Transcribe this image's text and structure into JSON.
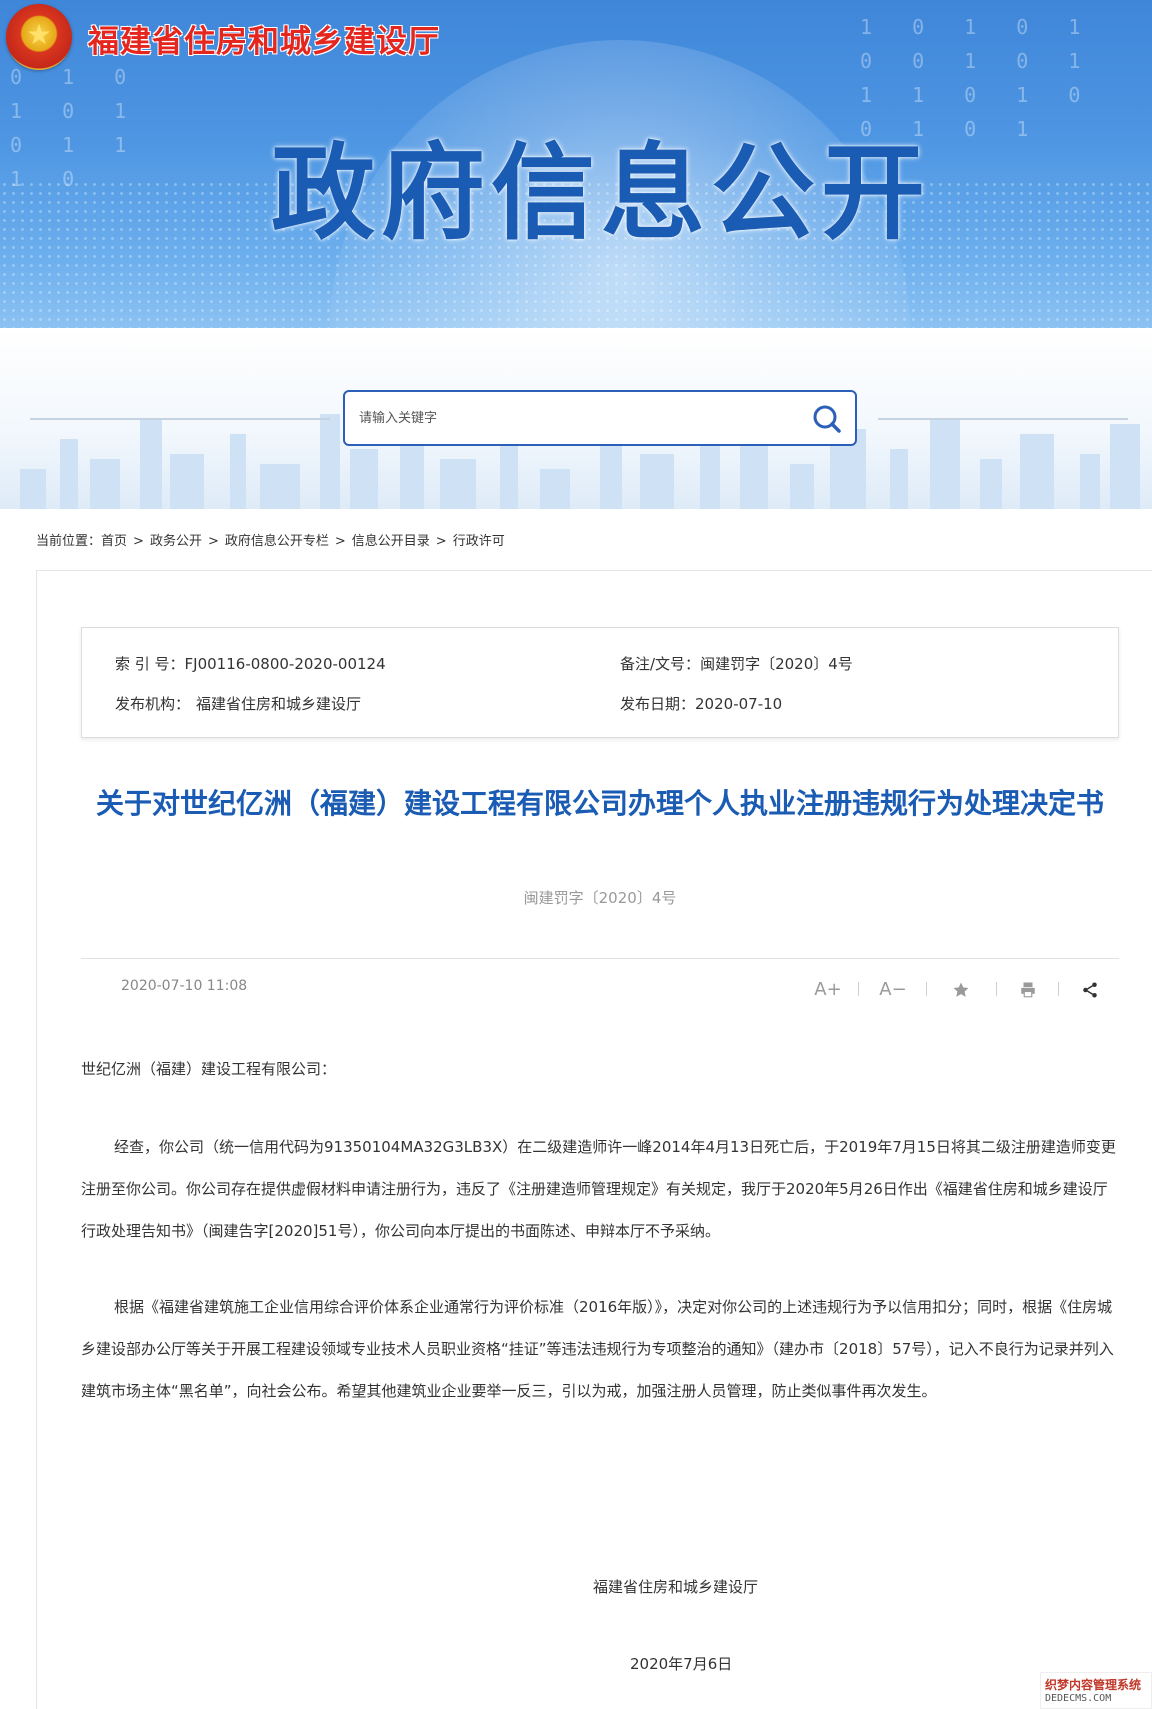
{
  "header": {
    "org_name": "福建省住房和城乡建设厅",
    "banner_title": "政府信息公开"
  },
  "search": {
    "placeholder": "请输入关键字"
  },
  "breadcrumb": {
    "label": "当前位置：",
    "items": [
      "首页",
      "政务公开",
      "政府信息公开专栏",
      "信息公开目录",
      "行政许可"
    ],
    "separator": ">"
  },
  "meta": {
    "index_label": "索 引 号：",
    "index_value": "FJ00116-0800-2020-00124",
    "doc_label": "备注/文号：",
    "doc_value": "闽建罚字〔2020〕4号",
    "publisher_label": "发布机构：",
    "publisher_value": "福建省住房和城乡建设厅",
    "date_label": "发布日期：",
    "date_value": "2020-07-10"
  },
  "article": {
    "title": "关于对世纪亿洲（福建）建设工程有限公司办理个人执业注册违规行为处理决定书",
    "doc_number": "闽建罚字〔2020〕4号",
    "publish_time": "2020-07-10 11:08",
    "tools": {
      "font_up": "A+",
      "font_down": "A−"
    },
    "salutation": "世纪亿洲（福建）建设工程有限公司：",
    "paragraph1": "经查，你公司（统一信用代码为91350104MA32G3LB3X）在二级建造师许一峰2014年4月13日死亡后，于2019年7月15日将其二级注册建造师变更注册至你公司。你公司存在提供虚假材料申请注册行为，违反了《注册建造师管理规定》有关规定，我厅于2020年5月26日作出《福建省住房和城乡建设厅行政处理告知书》（闽建告字[2020]51号），你公司向本厅提出的书面陈述、申辩本厅不予采纳。",
    "paragraph2": "根据《福建省建筑施工企业信用综合评价体系企业通常行为评价标准（2016年版）》，决定对你公司的上述违规行为予以信用扣分；同时，根据《住房城乡建设部办公厅等关于开展工程建设领域专业技术人员职业资格“挂证”等违法违规行为专项整治的通知》（建办市〔2018〕57号），记入不良行为记录并列入建筑市场主体“黑名单”，向社会公布。希望其他建筑业企业要举一反三，引以为戒，加强注册人员管理，防止类似事件再次发生。",
    "signature": "福建省住房和城乡建设厅",
    "sign_date": "2020年7月6日"
  },
  "watermark": {
    "line1": "织梦内容管理系统",
    "line2": "DEDECMS.COM"
  }
}
